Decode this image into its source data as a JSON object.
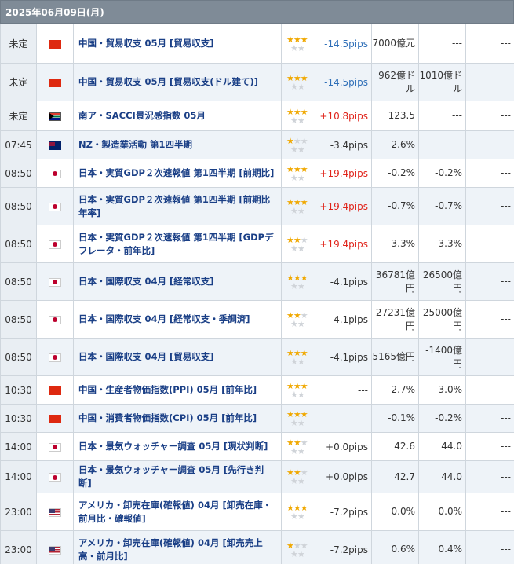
{
  "date_label": "2025年06月09日(月)",
  "rows": [
    {
      "time": "未定",
      "country": "cn",
      "title": "中国・貿易収支 05月 [貿易収支]",
      "stars": 3,
      "pips": "-14.5pips",
      "pips_class": "neg",
      "prev": "7000億元",
      "forecast": "---",
      "result": "---"
    },
    {
      "time": "未定",
      "country": "cn",
      "title": "中国・貿易収支 05月 [貿易収支(ドル建て)]",
      "stars": 3,
      "pips": "-14.5pips",
      "pips_class": "neg",
      "prev": "962億ドル",
      "forecast": "1010億ドル",
      "result": "---"
    },
    {
      "time": "未定",
      "country": "za",
      "title": "南ア・SACCI景況感指数 05月",
      "stars": 3,
      "pips": "+10.8pips",
      "pips_class": "pos",
      "prev": "123.5",
      "forecast": "---",
      "result": "---"
    },
    {
      "time": "07:45",
      "country": "nz",
      "title": "NZ・製造業活動 第1四半期",
      "stars": 1,
      "pips": "-3.4pips",
      "pips_class": "neu",
      "prev": "2.6%",
      "forecast": "---",
      "result": "---"
    },
    {
      "time": "08:50",
      "country": "jp",
      "title": "日本・実質GDP２次速報値 第1四半期 [前期比]",
      "stars": 3,
      "pips": "+19.4pips",
      "pips_class": "pos",
      "prev": "-0.2%",
      "forecast": "-0.2%",
      "result": "---"
    },
    {
      "time": "08:50",
      "country": "jp",
      "title": "日本・実質GDP２次速報値 第1四半期 [前期比年率]",
      "stars": 3,
      "pips": "+19.4pips",
      "pips_class": "pos",
      "prev": "-0.7%",
      "forecast": "-0.7%",
      "result": "---"
    },
    {
      "time": "08:50",
      "country": "jp",
      "title": "日本・実質GDP２次速報値 第1四半期 [GDPデフレータ・前年比]",
      "stars": 2,
      "pips": "+19.4pips",
      "pips_class": "pos",
      "prev": "3.3%",
      "forecast": "3.3%",
      "result": "---"
    },
    {
      "time": "08:50",
      "country": "jp",
      "title": "日本・国際収支 04月 [経常収支]",
      "stars": 3,
      "pips": "-4.1pips",
      "pips_class": "neu",
      "prev": "36781億円",
      "forecast": "26500億円",
      "result": "---"
    },
    {
      "time": "08:50",
      "country": "jp",
      "title": "日本・国際収支 04月 [経常収支・季調済]",
      "stars": 2,
      "pips": "-4.1pips",
      "pips_class": "neu",
      "prev": "27231億円",
      "forecast": "25000億円",
      "result": "---"
    },
    {
      "time": "08:50",
      "country": "jp",
      "title": "日本・国際収支 04月 [貿易収支]",
      "stars": 3,
      "pips": "-4.1pips",
      "pips_class": "neu",
      "prev": "5165億円",
      "forecast": "-1400億円",
      "result": "---"
    },
    {
      "time": "10:30",
      "country": "cn",
      "title": "中国・生産者物価指数(PPI) 05月 [前年比]",
      "stars": 3,
      "pips": "---",
      "pips_class": "neu",
      "prev": "-2.7%",
      "forecast": "-3.0%",
      "result": "---"
    },
    {
      "time": "10:30",
      "country": "cn",
      "title": "中国・消費者物価指数(CPI) 05月 [前年比]",
      "stars": 3,
      "pips": "---",
      "pips_class": "neu",
      "prev": "-0.1%",
      "forecast": "-0.2%",
      "result": "---"
    },
    {
      "time": "14:00",
      "country": "jp",
      "title": "日本・景気ウォッチャー調査 05月 [現状判断]",
      "stars": 2,
      "pips": "+0.0pips",
      "pips_class": "neu",
      "prev": "42.6",
      "forecast": "44.0",
      "result": "---"
    },
    {
      "time": "14:00",
      "country": "jp",
      "title": "日本・景気ウォッチャー調査 05月 [先行き判断]",
      "stars": 2,
      "pips": "+0.0pips",
      "pips_class": "neu",
      "prev": "42.7",
      "forecast": "44.0",
      "result": "---"
    },
    {
      "time": "23:00",
      "country": "us",
      "title": "アメリカ・卸売在庫(確報値) 04月 [卸売在庫・前月比・確報値]",
      "stars": 3,
      "pips": "-7.2pips",
      "pips_class": "neu",
      "prev": "0.0%",
      "forecast": "0.0%",
      "result": "---"
    },
    {
      "time": "23:00",
      "country": "us",
      "title": "アメリカ・卸売在庫(確報値) 04月 [卸売売上高・前月比]",
      "stars": 1,
      "pips": "-7.2pips",
      "pips_class": "neu",
      "prev": "0.6%",
      "forecast": "0.4%",
      "result": "---"
    }
  ]
}
